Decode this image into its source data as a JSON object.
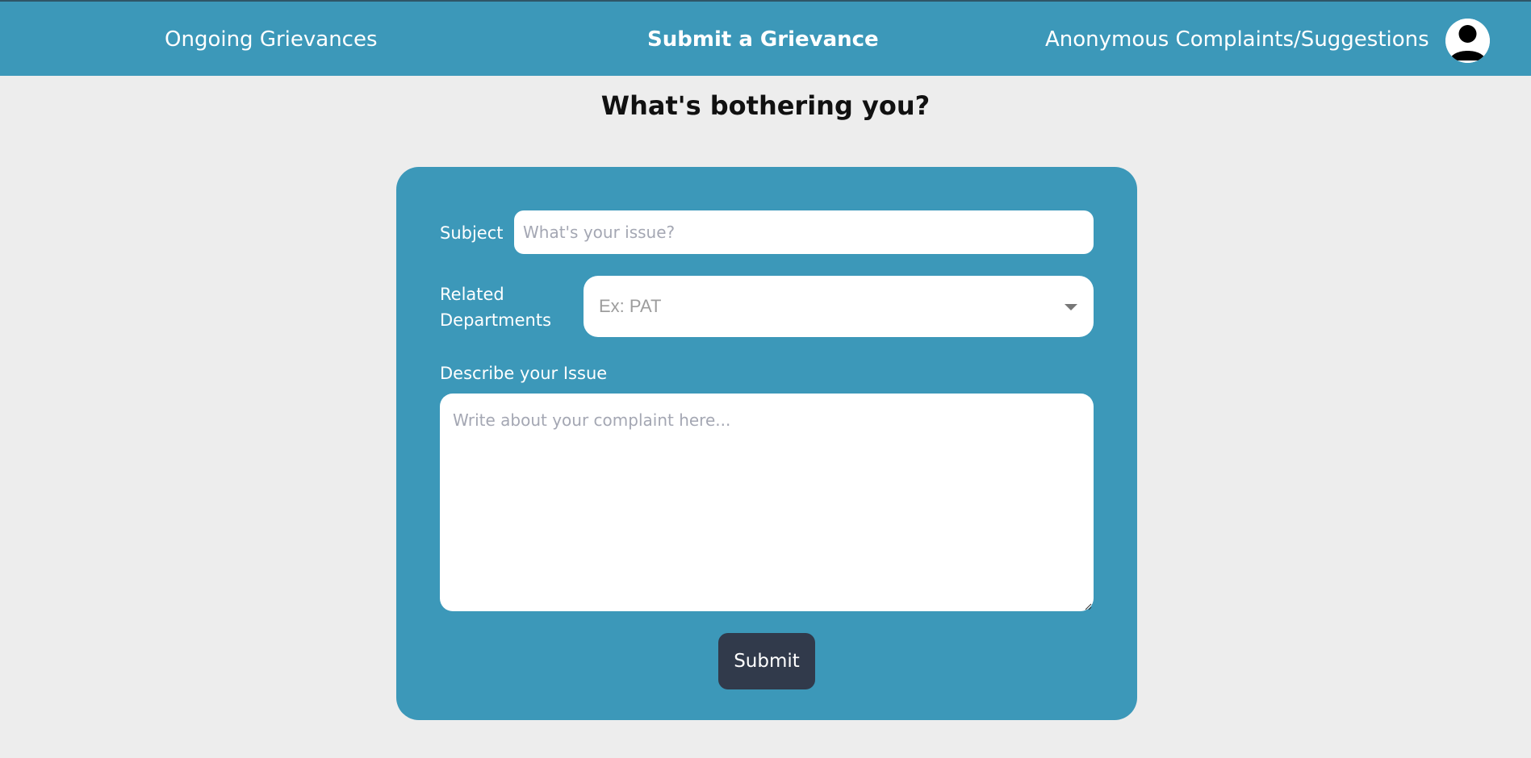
{
  "nav": {
    "items": [
      {
        "label": "Ongoing Grievances",
        "active": false
      },
      {
        "label": "Submit a Grievance",
        "active": true
      },
      {
        "label": "Anonymous Complaints/Suggestions",
        "active": false
      }
    ],
    "avatar_icon": "user-avatar-icon"
  },
  "page": {
    "title": "What's bothering you?"
  },
  "form": {
    "subject_label": "Subject",
    "subject_placeholder": "What's your issue?",
    "subject_value": "",
    "departments_label": "Related Departments",
    "departments_placeholder": "Ex: PAT",
    "departments_icon": "chevron-down-icon",
    "describe_label": "Describe your Issue",
    "describe_placeholder": "Write about your complaint here...",
    "describe_value": "",
    "submit_label": "Submit"
  },
  "colors": {
    "primary": "#3c98b9",
    "background": "#ededed",
    "button": "#313a4b",
    "text_on_primary": "#ffffff"
  }
}
